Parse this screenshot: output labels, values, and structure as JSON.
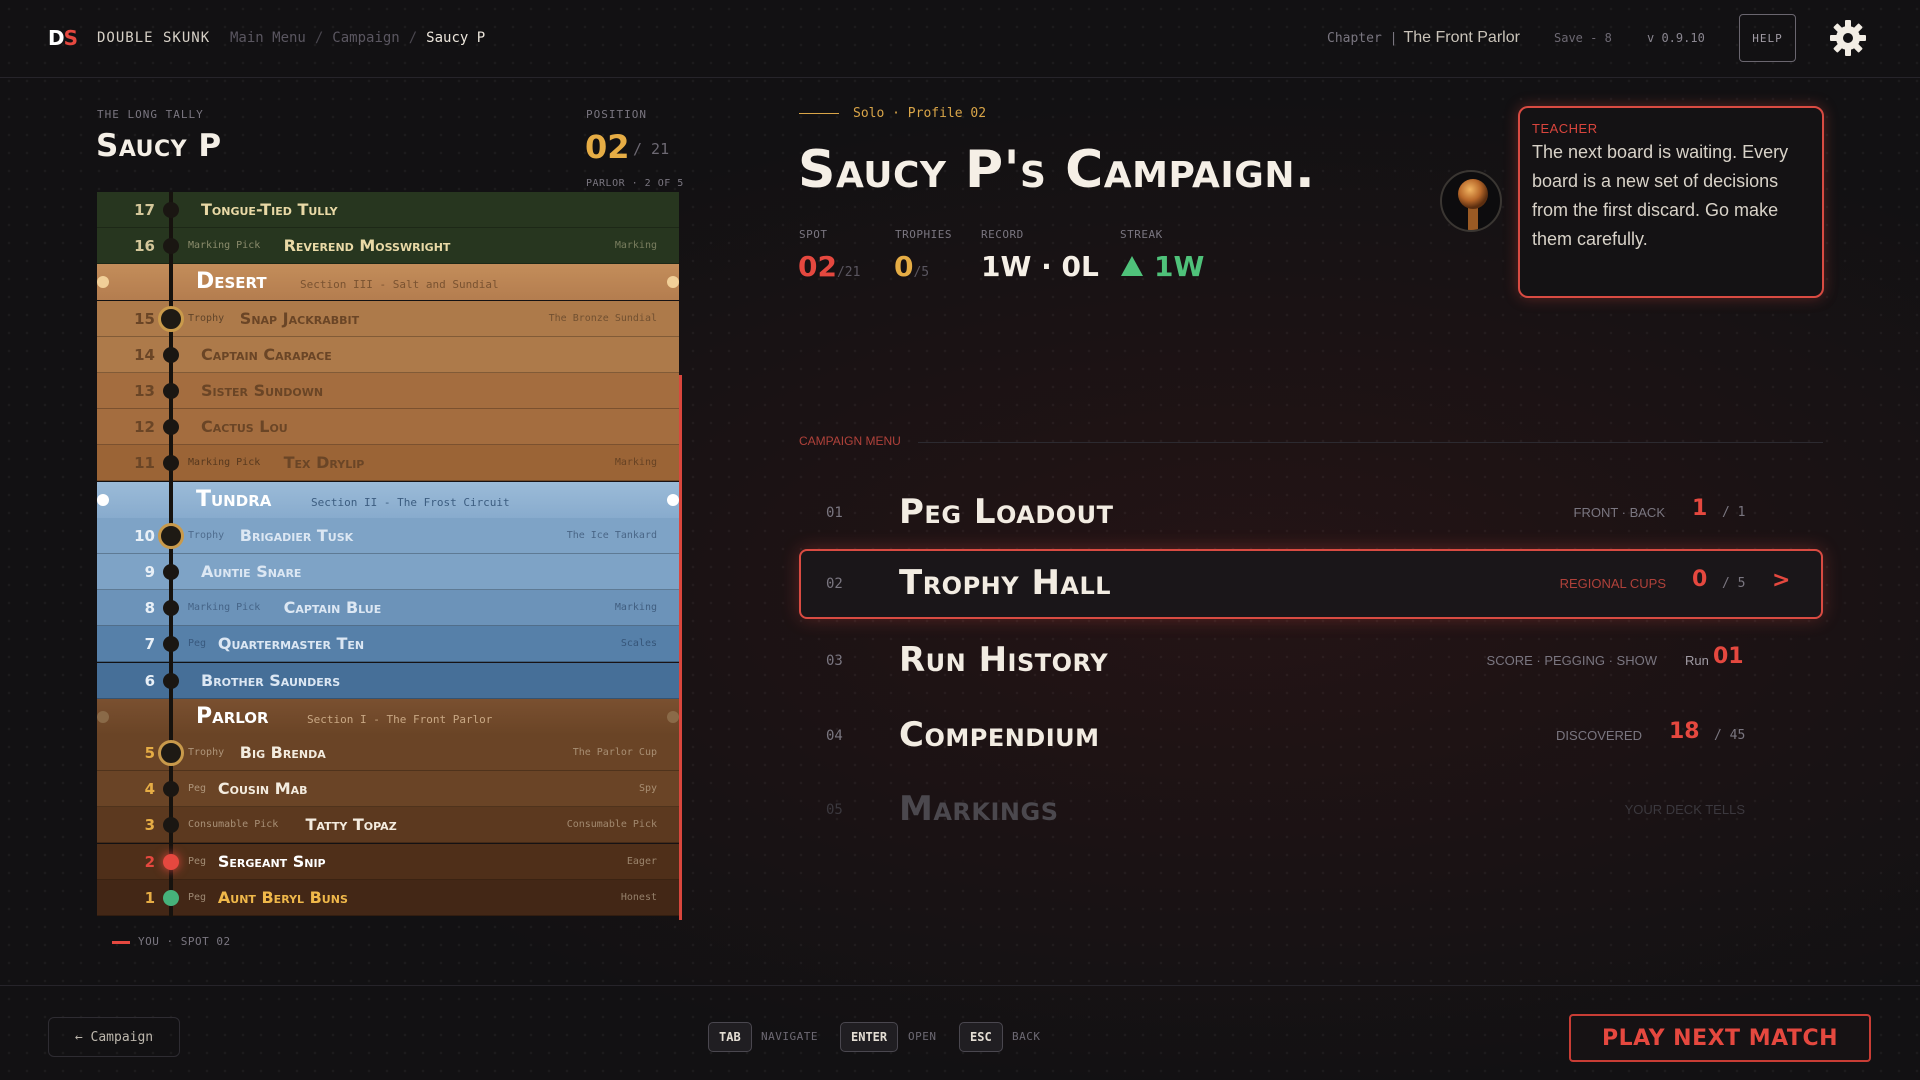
{
  "topbar": {
    "logo_d": "D",
    "logo_s": "S",
    "brand": "DOUBLE SKUNK",
    "breadcrumb": [
      "Main Menu",
      "Campaign",
      "Saucy P"
    ],
    "chapter_label": "Chapter |",
    "chapter_value": "The Front Parlor",
    "save": "Save - 8",
    "version": "v 0.9.10",
    "help": "HELP"
  },
  "tally": {
    "label": "THE LONG TALLY",
    "name": "Saucy P",
    "position_label": "POSITION",
    "position_value": "02",
    "position_total": "/ 21",
    "position_sub": "PARLOR · 2 OF 5",
    "you_legend": "YOU · SPOT 02"
  },
  "ladder": {
    "sections": [
      {
        "title": "Desert",
        "subtitle": "Section III - Salt and Sundial",
        "color": "#b47d4f"
      },
      {
        "title": "Tundra",
        "subtitle": "Section II - The Frost Circuit",
        "color": "#5c89b5"
      },
      {
        "title": "Parlor",
        "subtitle": "Section I - The Front Parlor",
        "color": "#6a4426"
      }
    ],
    "rows": [
      {
        "num": "17",
        "kind": "",
        "name": "Tongue-Tied Tully",
        "trait": ""
      },
      {
        "num": "16",
        "kind": "Marking Pick",
        "name": "Reverend Mosswright",
        "trait": "Marking"
      },
      {
        "num": "15",
        "kind": "Trophy",
        "name": "Snap Jackrabbit",
        "trait": "The Bronze Sundial"
      },
      {
        "num": "14",
        "kind": "",
        "name": "Captain Carapace",
        "trait": ""
      },
      {
        "num": "13",
        "kind": "",
        "name": "Sister Sundown",
        "trait": ""
      },
      {
        "num": "12",
        "kind": "",
        "name": "Cactus Lou",
        "trait": ""
      },
      {
        "num": "11",
        "kind": "Marking Pick",
        "name": "Tex Drylip",
        "trait": "Marking"
      },
      {
        "num": "10",
        "kind": "Trophy",
        "name": "Brigadier Tusk",
        "trait": "The Ice Tankard"
      },
      {
        "num": "9",
        "kind": "",
        "name": "Auntie Snare",
        "trait": ""
      },
      {
        "num": "8",
        "kind": "Marking Pick",
        "name": "Captain Blue",
        "trait": "Marking"
      },
      {
        "num": "7",
        "kind": "Peg",
        "name": "Quartermaster Ten",
        "trait": "Scales"
      },
      {
        "num": "6",
        "kind": "",
        "name": "Brother Saunders",
        "trait": ""
      },
      {
        "num": "5",
        "kind": "Trophy",
        "name": "Big Brenda",
        "trait": "The Parlor Cup"
      },
      {
        "num": "4",
        "kind": "Peg",
        "name": "Cousin Mab",
        "trait": "Spy"
      },
      {
        "num": "3",
        "kind": "Consumable Pick",
        "name": "Tatty Topaz",
        "trait": "Consumable Pick"
      },
      {
        "num": "2",
        "kind": "Peg",
        "name": "Sergeant Snip",
        "trait": "Eager"
      },
      {
        "num": "1",
        "kind": "Peg",
        "name": "Aunt Beryl Buns",
        "trait": "Honest"
      }
    ]
  },
  "campaign": {
    "profile": "Solo · Profile 02",
    "title": "Saucy P's Campaign.",
    "stats": {
      "spot_label": "SPOT",
      "spot_value": "02",
      "spot_total": "/21",
      "trophies_label": "TROPHIES",
      "trophies_value": "0",
      "trophies_total": "/5",
      "record_label": "RECORD",
      "record_value": "1W · 0L",
      "streak_label": "STREAK",
      "streak_value": "1W"
    },
    "teacher_label": "TEACHER",
    "teacher_message": "The next board is waiting. Every board is a new set of decisions from the first discard. Go make them carefully."
  },
  "menu": {
    "label": "CAMPAIGN MENU",
    "items": [
      {
        "idx": "01",
        "name": "Peg Loadout",
        "meta": "FRONT · BACK",
        "big": "1",
        "of": "/ 1"
      },
      {
        "idx": "02",
        "name": "Trophy Hall",
        "meta": "REGIONAL CUPS",
        "big": "0",
        "of": "/ 5",
        "arrow": ">"
      },
      {
        "idx": "03",
        "name": "Run History",
        "meta": "SCORE · PEGGING · SHOW",
        "pre": "Run",
        "big": "01",
        "of": ""
      },
      {
        "idx": "04",
        "name": "Compendium",
        "meta": "DISCOVERED",
        "big": "18",
        "of": "/ 45"
      },
      {
        "idx": "05",
        "name": "Markings",
        "meta": "YOUR DECK TELLS",
        "big": "",
        "of": ""
      }
    ]
  },
  "footer": {
    "back": "← Campaign",
    "keys": [
      {
        "key": "TAB",
        "desc": "NAVIGATE"
      },
      {
        "key": "ENTER",
        "desc": "OPEN"
      },
      {
        "key": "ESC",
        "desc": "BACK"
      }
    ],
    "play": "PLAY NEXT MATCH"
  },
  "colors": {
    "accent": "#e5483f",
    "gold": "#e6ad45",
    "green": "#46b27a"
  },
  "icons": [
    "gear-icon",
    "arrow-left-icon",
    "chevron-right-icon",
    "triangle-up-icon",
    "teacher-avatar"
  ]
}
